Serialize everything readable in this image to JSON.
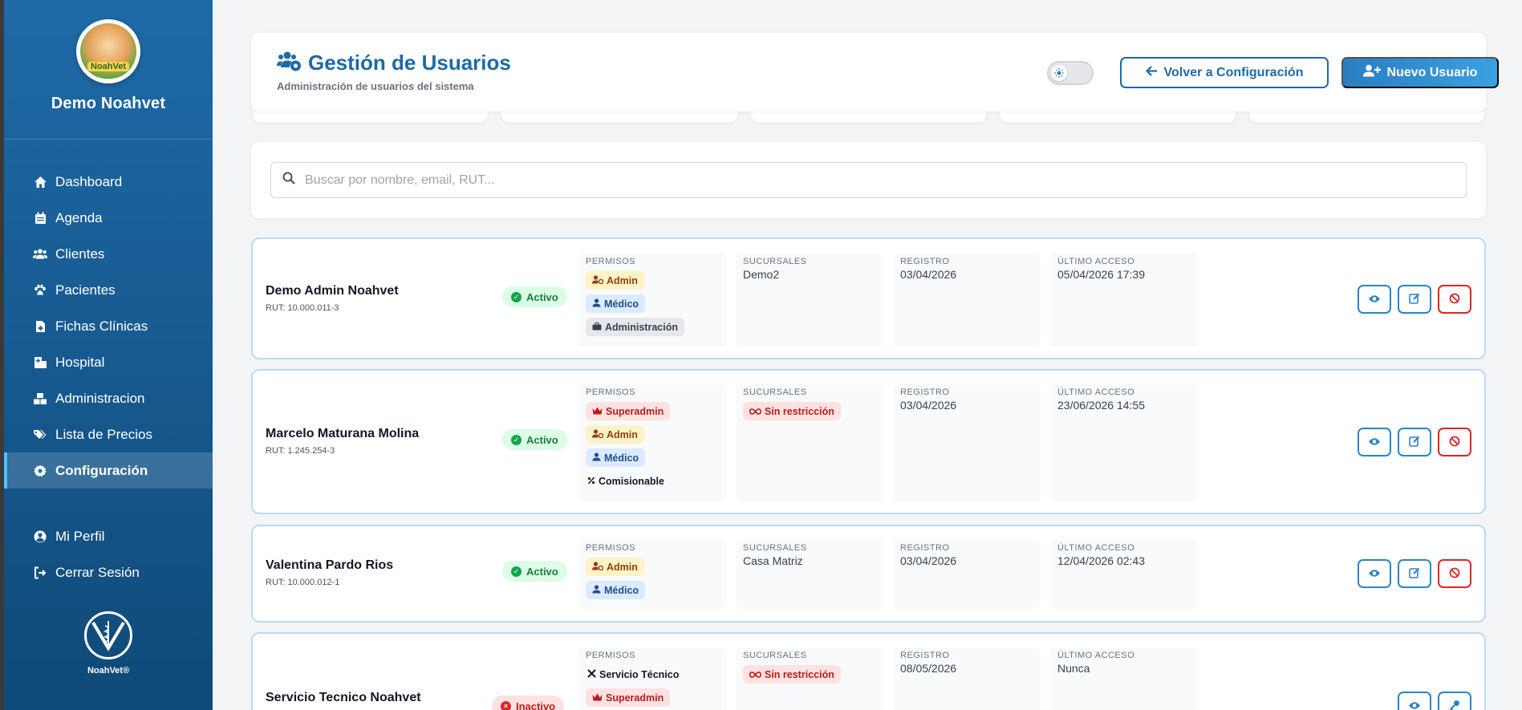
{
  "sidebar": {
    "brand_name": "Demo Noahvet",
    "logo_text": "NoahVet",
    "items": [
      {
        "label": "Dashboard",
        "icon": "home-icon"
      },
      {
        "label": "Agenda",
        "icon": "calendar-icon"
      },
      {
        "label": "Clientes",
        "icon": "users-icon"
      },
      {
        "label": "Pacientes",
        "icon": "paw-icon"
      },
      {
        "label": "Fichas Clínicas",
        "icon": "file-medical-icon"
      },
      {
        "label": "Hospital",
        "icon": "hospital-icon"
      },
      {
        "label": "Administracion",
        "icon": "boxes-icon"
      },
      {
        "label": "Lista de Precios",
        "icon": "tags-icon"
      },
      {
        "label": "Configuración",
        "icon": "gear-icon",
        "active": true
      }
    ],
    "bottom_items": [
      {
        "label": "Mi Perfil",
        "icon": "user-circle-icon"
      },
      {
        "label": "Cerrar Sesión",
        "icon": "logout-icon"
      }
    ],
    "footer_text": "NoahVet®"
  },
  "header": {
    "title": "Gestión de Usuarios",
    "subtitle": "Administración de usuarios del sistema",
    "back_label": "Volver a Configuración",
    "new_label": "Nuevo Usuario"
  },
  "search": {
    "placeholder": "Buscar por nombre, email, RUT..."
  },
  "labels": {
    "permisos": "PERMISOS",
    "sucursales": "SUCURSALES",
    "registro": "REGISTRO",
    "ultimo_acceso": "ÚLTIMO ACCESO"
  },
  "users": [
    {
      "name": "Demo Admin Noahvet",
      "rut": "RUT: 10.000.011-3",
      "status": "Activo",
      "permisos": [
        "Admin",
        "Médico",
        "Administración"
      ],
      "sucursales": "Demo2",
      "registro": "03/04/2026",
      "ultimo_acceso": "05/04/2026 17:39"
    },
    {
      "name": "Marcelo Maturana Molina",
      "rut": "RUT: 1.245.254-3",
      "status": "Activo",
      "permisos": [
        "Superadmin",
        "Admin",
        "Médico",
        "Comisionable"
      ],
      "sucursales": "Sin restricción",
      "registro": "03/04/2026",
      "ultimo_acceso": "23/06/2026 14:55"
    },
    {
      "name": "Valentina Pardo Rios",
      "rut": "RUT: 10.000.012-1",
      "status": "Activo",
      "permisos": [
        "Admin",
        "Médico"
      ],
      "sucursales": "Casa Matriz",
      "registro": "03/04/2026",
      "ultimo_acceso": "12/04/2026 02:43"
    },
    {
      "name": "Servicio Tecnico Noahvet",
      "status": "Inactivo",
      "permisos": [
        "Servicio Técnico",
        "Superadmin"
      ],
      "sucursales": "Sin restricción",
      "registro": "08/05/2026",
      "ultimo_acceso": "Nunca"
    }
  ],
  "colors": {
    "primary": "#1d6aa6",
    "sidebar_top": "#1e6aa7",
    "active_green": "#16a34a",
    "inactive_red": "#dc2626"
  }
}
